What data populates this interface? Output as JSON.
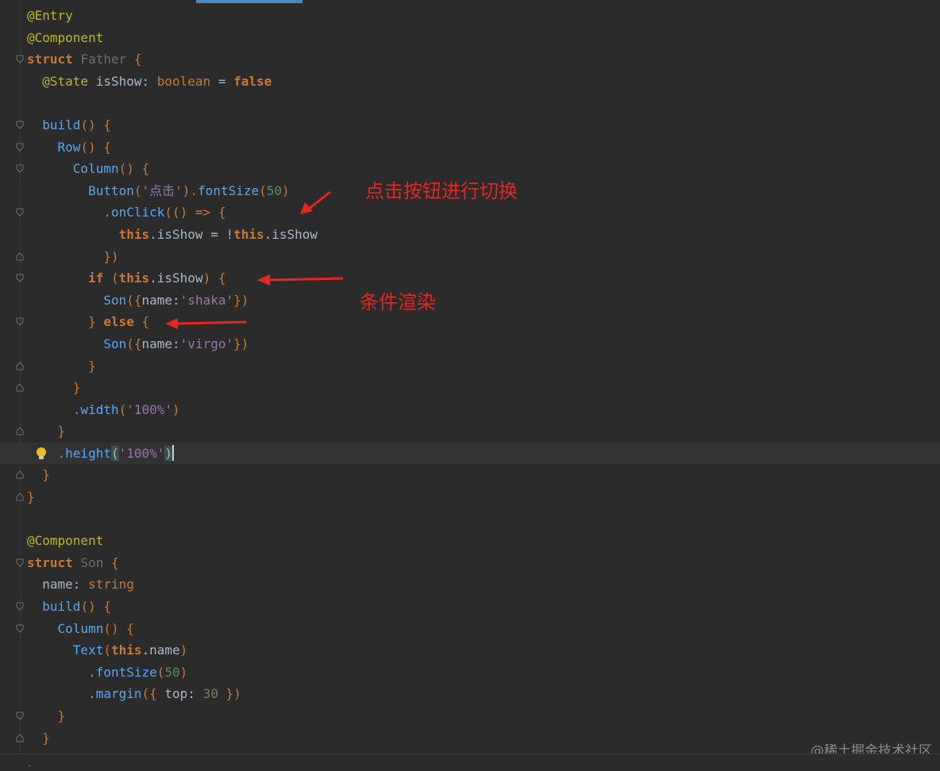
{
  "editor": {
    "lines": [
      {
        "tokens": [
          {
            "t": "@Entry",
            "c": "ann"
          }
        ]
      },
      {
        "tokens": [
          {
            "t": "@Component",
            "c": "ann"
          }
        ]
      },
      {
        "tokens": [
          {
            "t": "struct ",
            "c": "kw"
          },
          {
            "t": "Father ",
            "c": "cls"
          },
          {
            "t": "{",
            "c": "punc"
          }
        ]
      },
      {
        "tokens": [
          {
            "t": "  @State ",
            "c": "ann"
          },
          {
            "t": "isShow",
            "c": "plain"
          },
          {
            "t": ": ",
            "c": "plain"
          },
          {
            "t": "boolean",
            "c": "type"
          },
          {
            "t": " = ",
            "c": "plain"
          },
          {
            "t": "false",
            "c": "kw"
          }
        ]
      },
      {
        "tokens": []
      },
      {
        "tokens": [
          {
            "t": "  build",
            "c": "fn"
          },
          {
            "t": "() {",
            "c": "punc"
          }
        ]
      },
      {
        "tokens": [
          {
            "t": "    Row",
            "c": "fn"
          },
          {
            "t": "() {",
            "c": "punc"
          }
        ]
      },
      {
        "tokens": [
          {
            "t": "      Column",
            "c": "fn"
          },
          {
            "t": "() {",
            "c": "punc"
          }
        ]
      },
      {
        "tokens": [
          {
            "t": "        Button",
            "c": "fn"
          },
          {
            "t": "(",
            "c": "punc"
          },
          {
            "t": "'点击'",
            "c": "str"
          },
          {
            "t": ").",
            "c": "punc"
          },
          {
            "t": "fontSize",
            "c": "fn"
          },
          {
            "t": "(",
            "c": "punc"
          },
          {
            "t": "50",
            "c": "strq"
          },
          {
            "t": ")",
            "c": "punc"
          }
        ]
      },
      {
        "tokens": [
          {
            "t": "          .onClick",
            "c": "fn"
          },
          {
            "t": "(() => {",
            "c": "punc"
          }
        ]
      },
      {
        "tokens": [
          {
            "t": "            this",
            "c": "this"
          },
          {
            "t": ".isShow = !",
            "c": "plain"
          },
          {
            "t": "this",
            "c": "this"
          },
          {
            "t": ".isShow",
            "c": "plain"
          }
        ]
      },
      {
        "tokens": [
          {
            "t": "          })",
            "c": "punc"
          }
        ]
      },
      {
        "tokens": [
          {
            "t": "        if ",
            "c": "kw"
          },
          {
            "t": "(",
            "c": "punc"
          },
          {
            "t": "this",
            "c": "this"
          },
          {
            "t": ".isShow",
            "c": "plain"
          },
          {
            "t": ") {",
            "c": "punc"
          }
        ]
      },
      {
        "tokens": [
          {
            "t": "          Son",
            "c": "fn"
          },
          {
            "t": "({",
            "c": "punc"
          },
          {
            "t": "name",
            "c": "plain"
          },
          {
            "t": ":",
            "c": "plain"
          },
          {
            "t": "'shaka'",
            "c": "str"
          },
          {
            "t": "})",
            "c": "punc"
          }
        ]
      },
      {
        "tokens": [
          {
            "t": "        } ",
            "c": "punc"
          },
          {
            "t": "else ",
            "c": "kw"
          },
          {
            "t": "{",
            "c": "punc"
          }
        ]
      },
      {
        "tokens": [
          {
            "t": "          Son",
            "c": "fn"
          },
          {
            "t": "({",
            "c": "punc"
          },
          {
            "t": "name",
            "c": "plain"
          },
          {
            "t": ":",
            "c": "plain"
          },
          {
            "t": "'virgo'",
            "c": "str"
          },
          {
            "t": "})",
            "c": "punc"
          }
        ]
      },
      {
        "tokens": [
          {
            "t": "        }",
            "c": "punc"
          }
        ]
      },
      {
        "tokens": [
          {
            "t": "      }",
            "c": "punc"
          }
        ]
      },
      {
        "tokens": [
          {
            "t": "      .width",
            "c": "fn"
          },
          {
            "t": "(",
            "c": "punc"
          },
          {
            "t": "'100%'",
            "c": "str"
          },
          {
            "t": ")",
            "c": "punc"
          }
        ]
      },
      {
        "tokens": [
          {
            "t": "    }",
            "c": "punc"
          }
        ]
      },
      {
        "tokens": [
          {
            "t": "    .height",
            "c": "fn"
          },
          {
            "t": "(",
            "c": "match"
          },
          {
            "t": "'100%'",
            "c": "str"
          },
          {
            "t": ")",
            "c": "match"
          }
        ],
        "current": true
      },
      {
        "tokens": [
          {
            "t": "  }",
            "c": "punc"
          }
        ]
      },
      {
        "tokens": [
          {
            "t": "}",
            "c": "punc"
          }
        ]
      },
      {
        "tokens": []
      },
      {
        "tokens": [
          {
            "t": "@Component",
            "c": "ann"
          }
        ]
      },
      {
        "tokens": [
          {
            "t": "struct ",
            "c": "kw"
          },
          {
            "t": "Son ",
            "c": "cls"
          },
          {
            "t": "{",
            "c": "punc"
          }
        ]
      },
      {
        "tokens": [
          {
            "t": "  name",
            "c": "plain"
          },
          {
            "t": ": ",
            "c": "plain"
          },
          {
            "t": "string",
            "c": "type"
          }
        ]
      },
      {
        "tokens": [
          {
            "t": "  build",
            "c": "fn"
          },
          {
            "t": "() {",
            "c": "punc"
          }
        ]
      },
      {
        "tokens": [
          {
            "t": "    Column",
            "c": "fn"
          },
          {
            "t": "() {",
            "c": "punc"
          }
        ]
      },
      {
        "tokens": [
          {
            "t": "      Text",
            "c": "fn"
          },
          {
            "t": "(",
            "c": "punc"
          },
          {
            "t": "this",
            "c": "this"
          },
          {
            "t": ".name",
            "c": "plain"
          },
          {
            "t": ")",
            "c": "punc"
          }
        ]
      },
      {
        "tokens": [
          {
            "t": "        .fontSize",
            "c": "fn"
          },
          {
            "t": "(",
            "c": "punc"
          },
          {
            "t": "50",
            "c": "strq"
          },
          {
            "t": ")",
            "c": "punc"
          }
        ]
      },
      {
        "tokens": [
          {
            "t": "        .margin",
            "c": "fn"
          },
          {
            "t": "({ ",
            "c": "punc"
          },
          {
            "t": "top",
            "c": "plain"
          },
          {
            "t": ": ",
            "c": "plain"
          },
          {
            "t": "30",
            "c": "strq"
          },
          {
            "t": " })",
            "c": "punc"
          }
        ]
      },
      {
        "tokens": [
          {
            "t": "    }",
            "c": "punc"
          }
        ]
      },
      {
        "tokens": [
          {
            "t": "  }",
            "c": "punc"
          }
        ]
      },
      {
        "tokens": [
          {
            "t": "}",
            "c": "punc"
          }
        ]
      }
    ]
  },
  "annotations": {
    "click_toggle": "点击按钮进行切换",
    "conditional_render": "条件渲染"
  },
  "watermark": "@稀土掘金技术社区",
  "colors": {
    "annotation_red": "#e8251e",
    "editor_bg": "#2b2b2b"
  }
}
